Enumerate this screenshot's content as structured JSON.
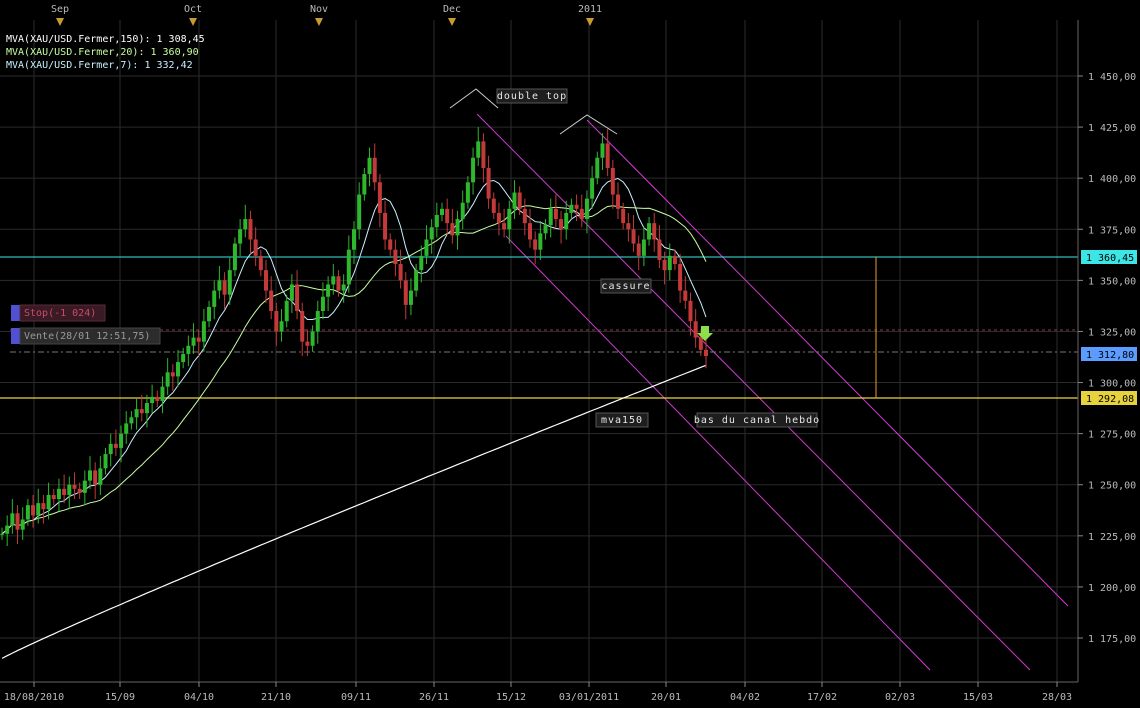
{
  "chart_data": {
    "type": "candlestick",
    "instrument": "XAU/USD",
    "legend": [
      {
        "text": "MVA(XAU/USD.Fermer,150): 1 308,45",
        "color": "#ffffff"
      },
      {
        "text": "MVA(XAU/USD.Fermer,20): 1 360,90",
        "color": "#c8ffa0"
      },
      {
        "text": "MVA(XAU/USD.Fermer,7): 1 332,42",
        "color": "#c8f0ff"
      }
    ],
    "month_labels": [
      "Sep",
      "Oct",
      "Nov",
      "Dec",
      "2011"
    ],
    "x_ticks": [
      "18/08/2010",
      "15/09",
      "04/10",
      "21/10",
      "09/11",
      "26/11",
      "15/12",
      "03/01/2011",
      "20/01",
      "04/02",
      "17/02",
      "02/03",
      "15/03",
      "28/03"
    ],
    "y_ticks": [
      "1 175,00",
      "1 200,00",
      "1 225,00",
      "1 250,00",
      "1 275,00",
      "1 300,00",
      "1 325,00",
      "1 350,00",
      "1 375,00",
      "1 400,00",
      "1 425,00",
      "1 450,00"
    ],
    "y_tick_values": [
      1175,
      1200,
      1225,
      1250,
      1275,
      1300,
      1325,
      1350,
      1375,
      1400,
      1425,
      1450
    ],
    "ylim": [
      1153,
      1480
    ],
    "price_markers": [
      {
        "label": "1 360,45",
        "value": 1360.45,
        "color": "#3ce6e6"
      },
      {
        "label": "1 312,80",
        "value": 1312.8,
        "color": "#5a9cff"
      },
      {
        "label": "1 292,08",
        "value": 1292.08,
        "color": "#e6d23c"
      }
    ],
    "orders": [
      {
        "label": "Stop(-1 024)",
        "value": 1324,
        "color": "#c84d6a"
      },
      {
        "label": "Vente(28/01 12:51,75)",
        "value": 1313,
        "color": "#aaaaaa"
      }
    ],
    "annotations": [
      "double top",
      "cassure",
      "mva150",
      "bas du canal hebdo"
    ],
    "series_start_close": 1226,
    "closes": [
      1226,
      1230,
      1236,
      1228,
      1233,
      1240,
      1235,
      1241,
      1238,
      1245,
      1243,
      1248,
      1245,
      1250,
      1248,
      1246,
      1252,
      1257,
      1250,
      1258,
      1265,
      1270,
      1268,
      1275,
      1280,
      1283,
      1287,
      1285,
      1290,
      1293,
      1291,
      1298,
      1305,
      1303,
      1310,
      1314,
      1318,
      1322,
      1320,
      1330,
      1337,
      1345,
      1350,
      1343,
      1355,
      1368,
      1375,
      1380,
      1370,
      1362,
      1355,
      1345,
      1335,
      1325,
      1330,
      1340,
      1348,
      1335,
      1320,
      1318,
      1325,
      1335,
      1342,
      1348,
      1352,
      1345,
      1348,
      1365,
      1375,
      1392,
      1402,
      1410,
      1398,
      1383,
      1370,
      1365,
      1358,
      1350,
      1338,
      1345,
      1355,
      1362,
      1370,
      1376,
      1382,
      1385,
      1378,
      1372,
      1380,
      1388,
      1398,
      1410,
      1418,
      1405,
      1390,
      1383,
      1378,
      1375,
      1385,
      1393,
      1385,
      1378,
      1370,
      1365,
      1373,
      1377,
      1385,
      1380,
      1375,
      1383,
      1387,
      1385,
      1380,
      1390,
      1400,
      1410,
      1417,
      1405,
      1392,
      1385,
      1378,
      1375,
      1368,
      1362,
      1370,
      1378,
      1370,
      1360,
      1355,
      1362,
      1358,
      1345,
      1340,
      1330,
      1322,
      1316,
      1313
    ]
  }
}
